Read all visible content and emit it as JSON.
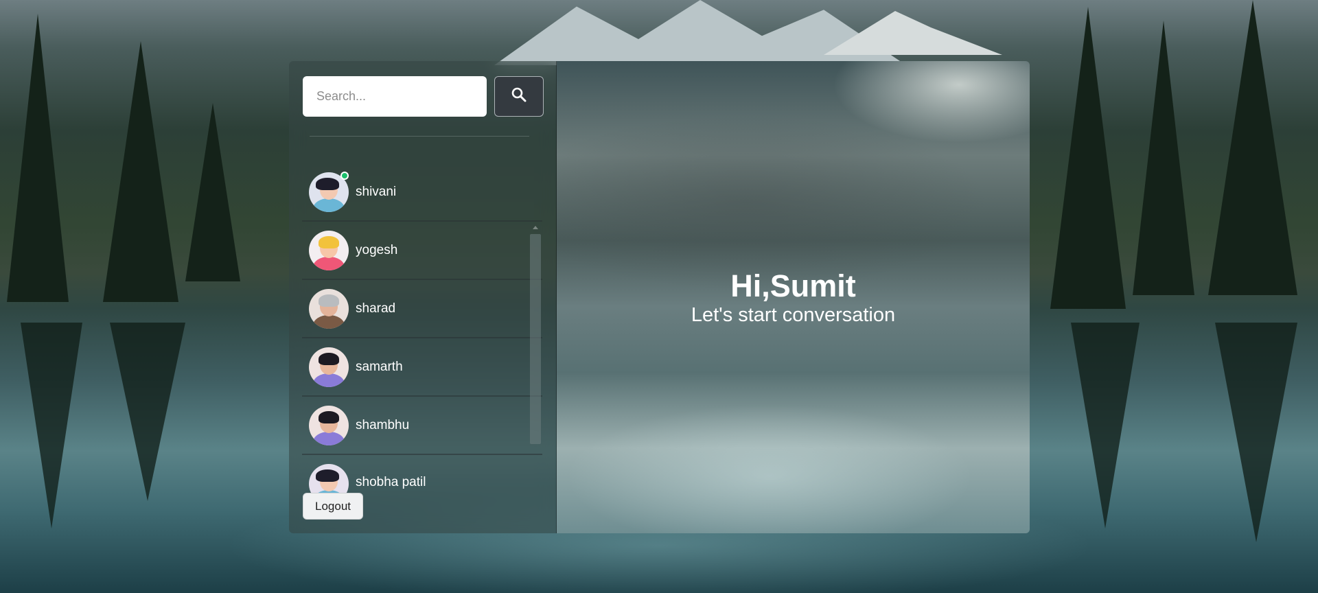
{
  "search": {
    "placeholder": "Search..."
  },
  "users": [
    {
      "name": "shivani",
      "online": true
    },
    {
      "name": "yogesh",
      "online": false
    },
    {
      "name": "sharad",
      "online": false
    },
    {
      "name": "samarth",
      "online": false
    },
    {
      "name": "shambhu",
      "online": false
    },
    {
      "name": "shobha patil",
      "online": false
    }
  ],
  "sidebar": {
    "logout_label": "Logout"
  },
  "main": {
    "greeting": "Hi,Sumit",
    "subtitle": "Let's start conversation"
  },
  "colors": {
    "online": "#1bbf6b",
    "search_button": "#343a40"
  },
  "icons": {
    "search_button": "search-icon"
  }
}
